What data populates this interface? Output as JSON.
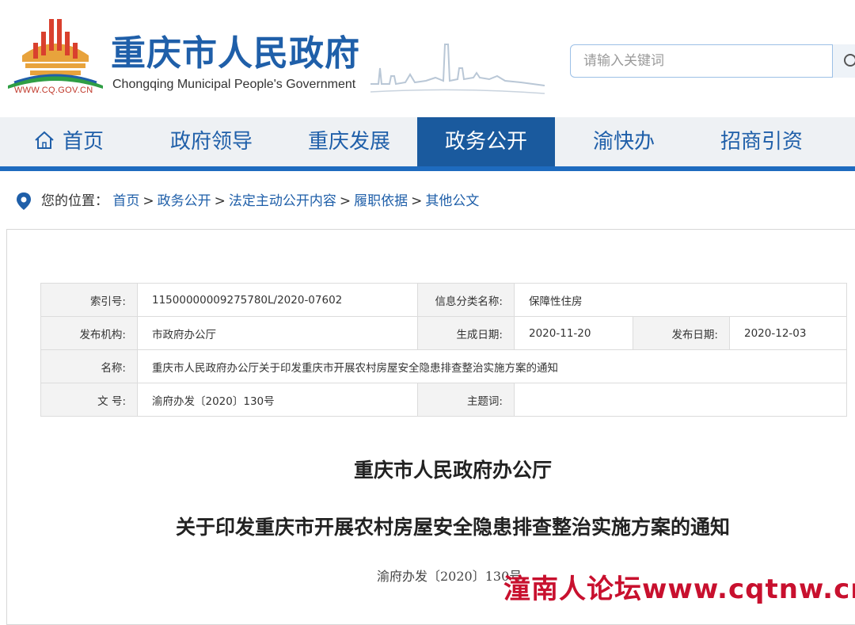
{
  "header": {
    "title": "重庆市人民政府",
    "subtitle": "Chongqing Municipal People's Government",
    "url": "WWW.CQ.GOV.CN"
  },
  "search": {
    "placeholder": "请输入关键词"
  },
  "nav": {
    "items": [
      {
        "label": "首页",
        "active": false
      },
      {
        "label": "政府领导",
        "active": false
      },
      {
        "label": "重庆发展",
        "active": false
      },
      {
        "label": "政务公开",
        "active": true
      },
      {
        "label": "渝快办",
        "active": false
      },
      {
        "label": "招商引资",
        "active": false
      }
    ]
  },
  "breadcrumb": {
    "prefix": "您的位置：",
    "items": [
      "首页",
      "政务公开",
      "法定主动公开内容",
      "履职依据",
      "其他公文"
    ],
    "separator": ">"
  },
  "meta": {
    "index_label": "索引号:",
    "index_value": "11500000009275780L/2020-07602",
    "category_label": "信息分类名称:",
    "category_value": "保障性住房",
    "org_label": "发布机构:",
    "org_value": "市政府办公厅",
    "created_label": "生成日期:",
    "created_value": "2020-11-20",
    "published_label": "发布日期:",
    "published_value": "2020-12-03",
    "name_label": "名称:",
    "name_value": "重庆市人民政府办公厅关于印发重庆市开展农村房屋安全隐患排查整治实施方案的通知",
    "docno_label": "文 号:",
    "docno_value": "渝府办发〔2020〕130号",
    "keywords_label": "主题词:",
    "keywords_value": ""
  },
  "document": {
    "issuer": "重庆市人民政府办公厅",
    "title": "关于印发重庆市开展农村房屋安全隐患排查整治实施方案的通知",
    "doc_number": "渝府办发〔2020〕130号"
  },
  "watermark": "潼南人论坛www.cqtnw.cn",
  "colors": {
    "brand_blue": "#1f5fa9",
    "nav_active": "#1a5a9e",
    "nav_bar": "#1e6bbf",
    "watermark": "#c8102e"
  }
}
